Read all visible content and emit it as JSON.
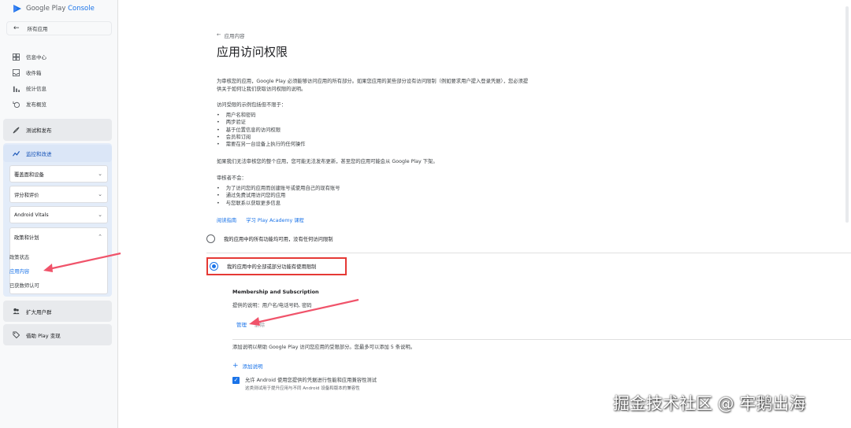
{
  "app": {
    "logo_google_play": "Google Play",
    "logo_console": "Console"
  },
  "sidebar": {
    "back_label": "所有应用",
    "nav": [
      {
        "label": "信息中心",
        "icon": "dashboard-icon"
      },
      {
        "label": "收件箱",
        "icon": "inbox-icon"
      },
      {
        "label": "统计信息",
        "icon": "bar-chart-icon"
      },
      {
        "label": "发布概览",
        "icon": "publishing-overview-icon"
      }
    ],
    "sections": {
      "test_release": "测试和发布",
      "monitor_improve": "监控和改进",
      "grow_users": "扩大用户群",
      "monetize": "借助 Play 变现"
    },
    "sub": {
      "reach_devices": "覆盖面和设备",
      "ratings_reviews": "评分和评价",
      "android_vitals": "Android Vitals",
      "policy_programs": "政策和计划",
      "policy_status": "政策状态",
      "app_content": "应用内容",
      "verified_developer": "已获数师认可"
    }
  },
  "main": {
    "breadcrumb": "应用内容",
    "title": "应用访问权限",
    "intro_line1": "为审核您的应用，Google Play 必须能够访问应用的所有部分。如果您应用的某些部分设有访问限制（例如要求用户提入登录凭据），您必须提",
    "intro_line2": "供关于如何让我们获取访问权限的说明。",
    "restrictions_heading": "访问受限的示例包括但不限于：",
    "restrictions": [
      "用户名和密码",
      "两步验证",
      "基于位置信息的访问权限",
      "会员和订阅",
      "需要在另一台设备上执行的任何操作"
    ],
    "warning": "如果我们无法审核您的整个应用，您可能无法发布更新，甚至您的应用可能会从 Google Play 下架。",
    "reviewers_heading": "审核者不会：",
    "reviewers": [
      "为了访问您的应用而创建账号或使用自己的现有账号",
      "通过免费试用访问您的应用",
      "与您联系以获取更多信息"
    ],
    "link_guide": "阅读指南",
    "link_academy": "学习 Play Academy 课程",
    "option_all": "我的应用中的所有功能均可用，没有任何访问限制",
    "option_restricted": "我的应用中的全部或部分功能有使用限制",
    "membership_title": "Membership and Subscription",
    "provided_desc": "提供的说明：用户名/电话号码, 密码",
    "manage_label": "管理",
    "manage_suffix": "删除",
    "add_info": "添加说明以帮助 Google Play 访问您应用的受限部分。您最多可以添加 5 条说明。",
    "add_desc_label": "添加说明",
    "allow_label": "允许 Android 使用您提供的凭据进行性能和应用兼容性测试",
    "allow_sub": "这类测试用于提升应用与不同 Android 设备和版本的兼容性"
  },
  "watermark": "掘金技术社区 @ 牢鹅出海",
  "colors": {
    "accent": "#1a73e8",
    "highlight": "#e53935",
    "active_section": "#dbe6f7"
  }
}
